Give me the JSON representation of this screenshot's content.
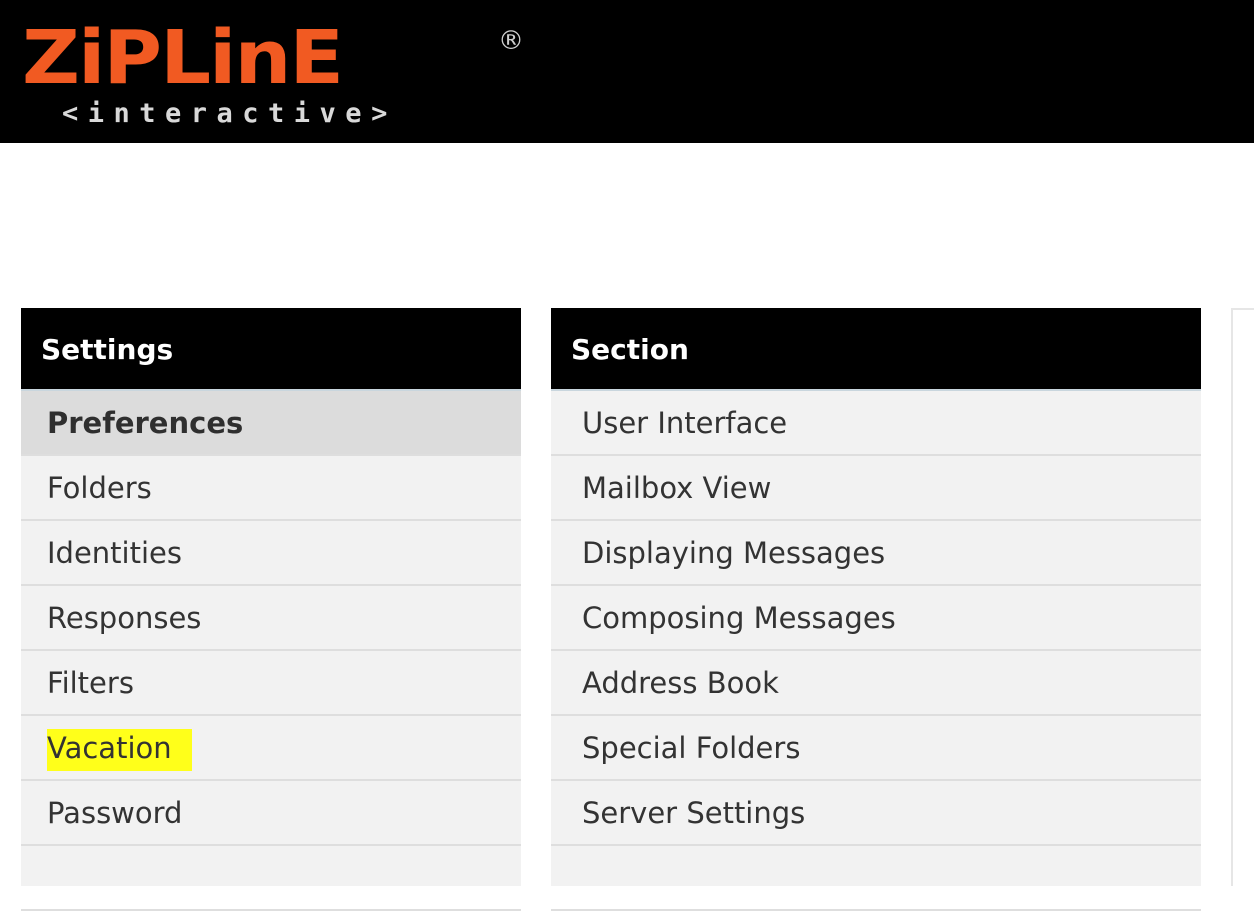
{
  "header": {
    "logo": {
      "main_text": "ZiPLinE",
      "registered_mark": "®",
      "sub_text": "<interactive>"
    },
    "colors": {
      "background": "#000000",
      "brand_orange": "#f15a22"
    }
  },
  "settings_panel": {
    "title": "Settings",
    "items": [
      {
        "label": "Preferences",
        "selected": true
      },
      {
        "label": "Folders"
      },
      {
        "label": "Identities"
      },
      {
        "label": "Responses"
      },
      {
        "label": "Filters"
      },
      {
        "label": "Vacation",
        "highlighted": true,
        "highlight_color": "#ffff1a"
      },
      {
        "label": "Password"
      }
    ]
  },
  "section_panel": {
    "title": "Section",
    "items": [
      {
        "label": "User Interface"
      },
      {
        "label": "Mailbox View"
      },
      {
        "label": "Displaying Messages"
      },
      {
        "label": "Composing Messages"
      },
      {
        "label": "Address Book"
      },
      {
        "label": "Special Folders"
      },
      {
        "label": "Server Settings"
      }
    ]
  }
}
